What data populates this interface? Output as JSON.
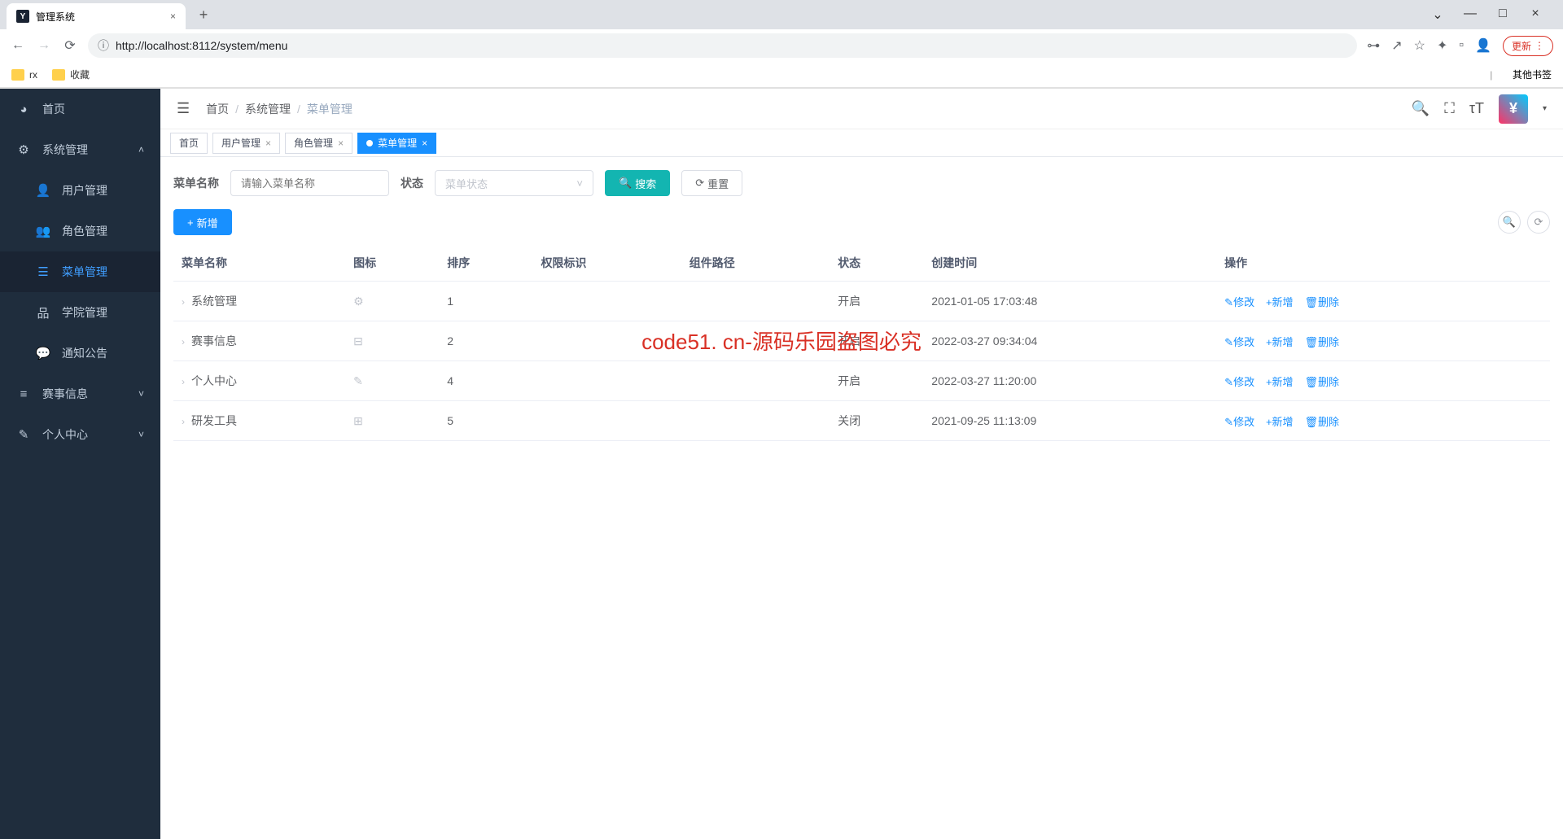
{
  "browser": {
    "tab_title": "管理系统",
    "url": "http://localhost:8112/system/menu",
    "update_label": "更新",
    "bookmarks": [
      "rx",
      "收藏"
    ],
    "other_bookmarks": "其他书签"
  },
  "sidebar": {
    "items": [
      {
        "label": "首页",
        "icon": "dashboard"
      },
      {
        "label": "系统管理",
        "icon": "gear",
        "expanded": true
      },
      {
        "label": "用户管理",
        "sub": true
      },
      {
        "label": "角色管理",
        "sub": true
      },
      {
        "label": "菜单管理",
        "sub": true,
        "active": true
      },
      {
        "label": "学院管理",
        "sub": true
      },
      {
        "label": "通知公告",
        "sub": true
      },
      {
        "label": "赛事信息",
        "icon": "list"
      },
      {
        "label": "个人中心",
        "icon": "edit"
      }
    ]
  },
  "breadcrumb": [
    "首页",
    "系统管理",
    "菜单管理"
  ],
  "tags": [
    {
      "label": "首页",
      "closable": false
    },
    {
      "label": "用户管理",
      "closable": true
    },
    {
      "label": "角色管理",
      "closable": true
    },
    {
      "label": "菜单管理",
      "closable": true,
      "active": true
    }
  ],
  "search": {
    "name_label": "菜单名称",
    "name_placeholder": "请输入菜单名称",
    "status_label": "状态",
    "status_placeholder": "菜单状态",
    "search_btn": "搜索",
    "reset_btn": "重置"
  },
  "toolbar": {
    "add_btn": "新增"
  },
  "table": {
    "columns": [
      "菜单名称",
      "图标",
      "排序",
      "权限标识",
      "组件路径",
      "状态",
      "创建时间",
      "操作"
    ],
    "actions": {
      "edit": "修改",
      "add": "新增",
      "delete": "删除"
    },
    "rows": [
      {
        "name": "系统管理",
        "icon": "⚙",
        "sort": "1",
        "perm": "",
        "path": "",
        "status": "开启",
        "created": "2021-01-05 17:03:48"
      },
      {
        "name": "赛事信息",
        "icon": "⊟",
        "sort": "2",
        "perm": "",
        "path": "",
        "status": "开启",
        "created": "2022-03-27 09:34:04"
      },
      {
        "name": "个人中心",
        "icon": "✎",
        "sort": "4",
        "perm": "",
        "path": "",
        "status": "开启",
        "created": "2022-03-27 11:20:00"
      },
      {
        "name": "研发工具",
        "icon": "⊞",
        "sort": "5",
        "perm": "",
        "path": "",
        "status": "关闭",
        "created": "2021-09-25 11:13:09"
      }
    ]
  },
  "watermark": "code51. cn-源码乐园盗图必究"
}
